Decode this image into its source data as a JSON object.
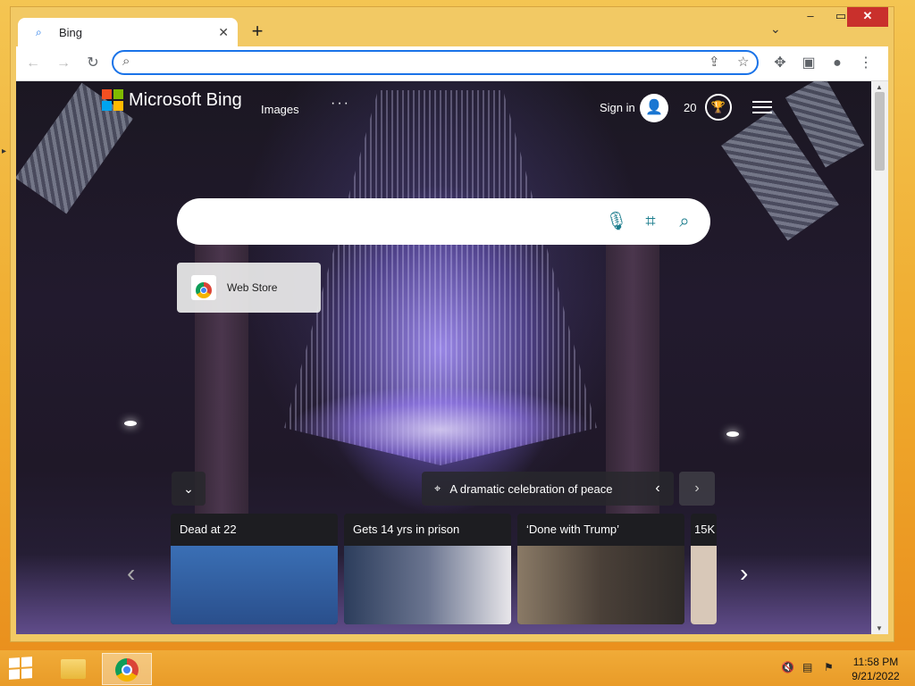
{
  "browser": {
    "tab_title": "Bing",
    "omnibox_value": "",
    "omnibox_placeholder": ""
  },
  "bing": {
    "logo_text": "Microsoft Bing",
    "nav_images": "Images",
    "nav_more": "···",
    "sign_in": "Sign in",
    "points": "20",
    "search_value": "",
    "web_store": "Web Store",
    "caption": "A dramatic celebration of peace",
    "news": [
      {
        "headline": "Dead at 22"
      },
      {
        "headline": "Gets 14 yrs in prison"
      },
      {
        "headline": "‘Done with Trump’"
      },
      {
        "headline": "15K"
      }
    ]
  },
  "taskbar": {
    "time": "11:58 PM",
    "date": "9/21/2022"
  },
  "colors": {
    "accent": "#1a73e8",
    "bing_icon": "#1a7c8c",
    "close_red": "#c9302c",
    "desktop_orange": "#efa92c"
  },
  "icons": [
    "search-icon",
    "close-icon",
    "plus-icon",
    "chevron-down-icon",
    "back-icon",
    "forward-icon",
    "reload-icon",
    "share-icon",
    "star-icon",
    "puzzle-icon",
    "sidepanel-icon",
    "profile-icon",
    "more-icon",
    "microphone-icon",
    "visual-search-icon",
    "trophy-icon",
    "hamburger-icon",
    "location-pin-icon",
    "chevron-left-icon",
    "chevron-right-icon",
    "windows-start-icon",
    "file-explorer-icon",
    "chrome-icon",
    "volume-muted-icon",
    "network-icon",
    "flag-icon"
  ]
}
